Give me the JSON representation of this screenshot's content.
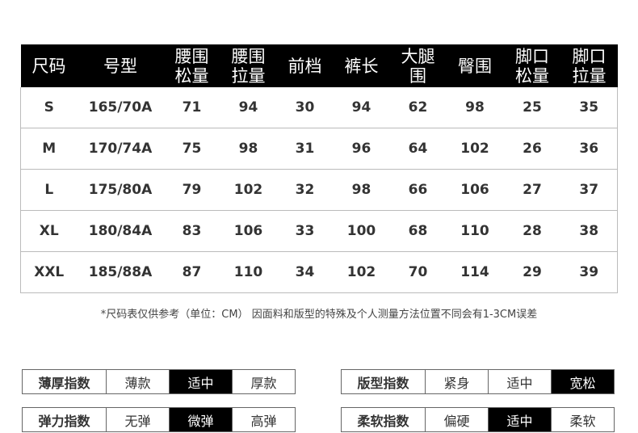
{
  "size_table": {
    "headers": [
      [
        "尺码"
      ],
      [
        "号型"
      ],
      [
        "腰围",
        "松量"
      ],
      [
        "腰围",
        "拉量"
      ],
      [
        "前档"
      ],
      [
        "裤长"
      ],
      [
        "大腿",
        "围"
      ],
      [
        "臀围"
      ],
      [
        "脚口",
        "松量"
      ],
      [
        "脚口",
        "拉量"
      ]
    ],
    "rows": [
      [
        "S",
        "165/70A",
        "71",
        "94",
        "30",
        "94",
        "62",
        "98",
        "25",
        "35"
      ],
      [
        "M",
        "170/74A",
        "75",
        "98",
        "31",
        "96",
        "64",
        "102",
        "26",
        "36"
      ],
      [
        "L",
        "175/80A",
        "79",
        "102",
        "32",
        "98",
        "66",
        "106",
        "27",
        "37"
      ],
      [
        "XL",
        "180/84A",
        "83",
        "106",
        "33",
        "100",
        "68",
        "110",
        "28",
        "38"
      ],
      [
        "XXL",
        "185/88A",
        "87",
        "110",
        "34",
        "102",
        "70",
        "114",
        "29",
        "39"
      ]
    ]
  },
  "note": "*尺码表仅供参考（单位：CM） 因面料和版型的特殊及个人测量方法位置不同会有1-3CM误差",
  "indexes": {
    "thickness": {
      "label": "薄厚指数",
      "options": [
        "薄款",
        "适中",
        "厚款"
      ],
      "selected": 1
    },
    "elastic": {
      "label": "弹力指数",
      "options": [
        "无弹",
        "微弹",
        "高弹"
      ],
      "selected": 1
    },
    "fit": {
      "label": "版型指数",
      "options": [
        "紧身",
        "适中",
        "宽松"
      ],
      "selected": 2
    },
    "soft": {
      "label": "柔软指数",
      "options": [
        "偏硬",
        "适中",
        "柔软"
      ],
      "selected": 1
    }
  },
  "colors": {
    "header_bg": "#000000",
    "selected_bg": "#000000",
    "border": "#bbbbbb"
  }
}
